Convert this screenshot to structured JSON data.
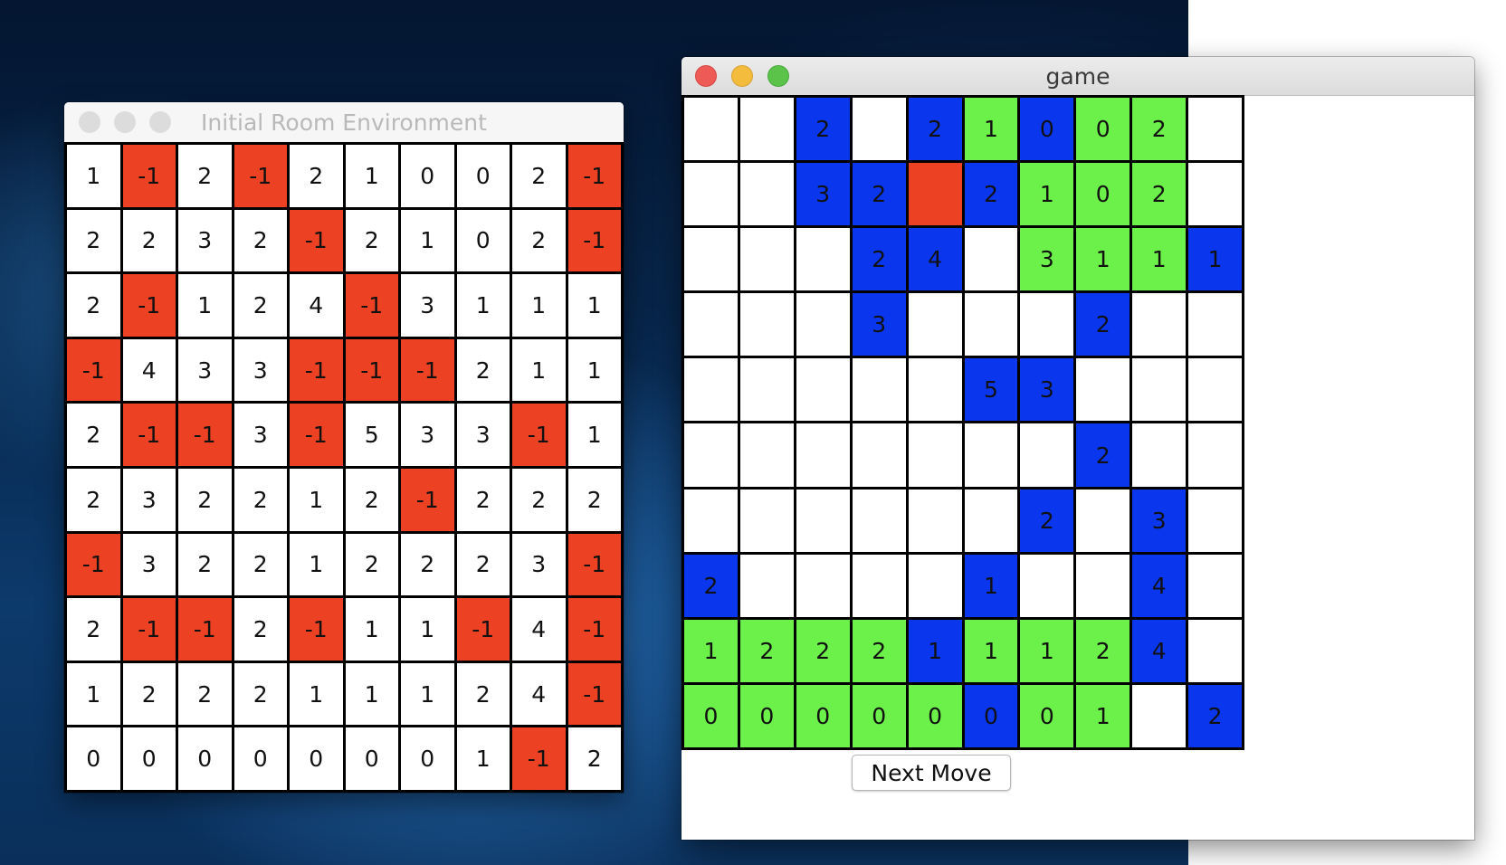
{
  "colors": {
    "obstacle": "#ec4123",
    "empty": "#ffffff",
    "visited": "#6cf04a",
    "frontier": "#0a37ee",
    "grid_line": "#000000",
    "close": "#ee5a55",
    "minimize": "#f4bc3c",
    "zoom": "#5bc34a",
    "inactive_dot": "#dcdcdc"
  },
  "env_window": {
    "title": "Initial Room Environment",
    "grid": [
      [
        "1",
        "-1",
        "2",
        "-1",
        "2",
        "1",
        "0",
        "0",
        "2",
        "-1"
      ],
      [
        "2",
        "2",
        "3",
        "2",
        "-1",
        "2",
        "1",
        "0",
        "2",
        "-1"
      ],
      [
        "2",
        "-1",
        "1",
        "2",
        "4",
        "-1",
        "3",
        "1",
        "1",
        "1"
      ],
      [
        "-1",
        "4",
        "3",
        "3",
        "-1",
        "-1",
        "-1",
        "2",
        "1",
        "1"
      ],
      [
        "2",
        "-1",
        "-1",
        "3",
        "-1",
        "5",
        "3",
        "3",
        "-1",
        "1"
      ],
      [
        "2",
        "3",
        "2",
        "2",
        "1",
        "2",
        "-1",
        "2",
        "2",
        "2"
      ],
      [
        "-1",
        "3",
        "2",
        "2",
        "1",
        "2",
        "2",
        "2",
        "3",
        "-1"
      ],
      [
        "2",
        "-1",
        "-1",
        "2",
        "-1",
        "1",
        "1",
        "-1",
        "4",
        "-1"
      ],
      [
        "1",
        "2",
        "2",
        "2",
        "1",
        "1",
        "1",
        "2",
        "4",
        "-1"
      ],
      [
        "0",
        "0",
        "0",
        "0",
        "0",
        "0",
        "0",
        "1",
        "-1",
        "2"
      ]
    ]
  },
  "game_window": {
    "title": "game",
    "next_move_label": "Next Move",
    "grid": [
      [
        {
          "v": "",
          "s": "empty"
        },
        {
          "v": "",
          "s": "empty"
        },
        {
          "v": "2",
          "s": "frontier"
        },
        {
          "v": "",
          "s": "empty"
        },
        {
          "v": "2",
          "s": "frontier"
        },
        {
          "v": "1",
          "s": "visited"
        },
        {
          "v": "0",
          "s": "frontier"
        },
        {
          "v": "0",
          "s": "visited"
        },
        {
          "v": "2",
          "s": "visited"
        },
        {
          "v": "",
          "s": "empty"
        }
      ],
      [
        {
          "v": "",
          "s": "empty"
        },
        {
          "v": "",
          "s": "empty"
        },
        {
          "v": "3",
          "s": "frontier"
        },
        {
          "v": "2",
          "s": "frontier"
        },
        {
          "v": "",
          "s": "obstacle"
        },
        {
          "v": "2",
          "s": "frontier"
        },
        {
          "v": "1",
          "s": "visited"
        },
        {
          "v": "0",
          "s": "visited"
        },
        {
          "v": "2",
          "s": "visited"
        },
        {
          "v": "",
          "s": "empty"
        }
      ],
      [
        {
          "v": "",
          "s": "empty"
        },
        {
          "v": "",
          "s": "empty"
        },
        {
          "v": "",
          "s": "empty"
        },
        {
          "v": "2",
          "s": "frontier"
        },
        {
          "v": "4",
          "s": "frontier"
        },
        {
          "v": "",
          "s": "empty"
        },
        {
          "v": "3",
          "s": "visited"
        },
        {
          "v": "1",
          "s": "visited"
        },
        {
          "v": "1",
          "s": "visited"
        },
        {
          "v": "1",
          "s": "frontier"
        }
      ],
      [
        {
          "v": "",
          "s": "empty"
        },
        {
          "v": "",
          "s": "empty"
        },
        {
          "v": "",
          "s": "empty"
        },
        {
          "v": "3",
          "s": "frontier"
        },
        {
          "v": "",
          "s": "empty"
        },
        {
          "v": "",
          "s": "empty"
        },
        {
          "v": "",
          "s": "empty"
        },
        {
          "v": "2",
          "s": "frontier"
        },
        {
          "v": "",
          "s": "empty"
        },
        {
          "v": "",
          "s": "empty"
        }
      ],
      [
        {
          "v": "",
          "s": "empty"
        },
        {
          "v": "",
          "s": "empty"
        },
        {
          "v": "",
          "s": "empty"
        },
        {
          "v": "",
          "s": "empty"
        },
        {
          "v": "",
          "s": "empty"
        },
        {
          "v": "5",
          "s": "frontier"
        },
        {
          "v": "3",
          "s": "frontier"
        },
        {
          "v": "",
          "s": "empty"
        },
        {
          "v": "",
          "s": "empty"
        },
        {
          "v": "",
          "s": "empty"
        }
      ],
      [
        {
          "v": "",
          "s": "empty"
        },
        {
          "v": "",
          "s": "empty"
        },
        {
          "v": "",
          "s": "empty"
        },
        {
          "v": "",
          "s": "empty"
        },
        {
          "v": "",
          "s": "empty"
        },
        {
          "v": "",
          "s": "empty"
        },
        {
          "v": "",
          "s": "empty"
        },
        {
          "v": "2",
          "s": "frontier"
        },
        {
          "v": "",
          "s": "empty"
        },
        {
          "v": "",
          "s": "empty"
        }
      ],
      [
        {
          "v": "",
          "s": "empty"
        },
        {
          "v": "",
          "s": "empty"
        },
        {
          "v": "",
          "s": "empty"
        },
        {
          "v": "",
          "s": "empty"
        },
        {
          "v": "",
          "s": "empty"
        },
        {
          "v": "",
          "s": "empty"
        },
        {
          "v": "2",
          "s": "frontier"
        },
        {
          "v": "",
          "s": "empty"
        },
        {
          "v": "3",
          "s": "frontier"
        },
        {
          "v": "",
          "s": "empty"
        }
      ],
      [
        {
          "v": "2",
          "s": "frontier"
        },
        {
          "v": "",
          "s": "empty"
        },
        {
          "v": "",
          "s": "empty"
        },
        {
          "v": "",
          "s": "empty"
        },
        {
          "v": "",
          "s": "empty"
        },
        {
          "v": "1",
          "s": "frontier"
        },
        {
          "v": "",
          "s": "empty"
        },
        {
          "v": "",
          "s": "empty"
        },
        {
          "v": "4",
          "s": "frontier"
        },
        {
          "v": "",
          "s": "empty"
        }
      ],
      [
        {
          "v": "1",
          "s": "visited"
        },
        {
          "v": "2",
          "s": "visited"
        },
        {
          "v": "2",
          "s": "visited"
        },
        {
          "v": "2",
          "s": "visited"
        },
        {
          "v": "1",
          "s": "frontier"
        },
        {
          "v": "1",
          "s": "visited"
        },
        {
          "v": "1",
          "s": "visited"
        },
        {
          "v": "2",
          "s": "visited"
        },
        {
          "v": "4",
          "s": "frontier"
        },
        {
          "v": "",
          "s": "empty"
        }
      ],
      [
        {
          "v": "0",
          "s": "visited"
        },
        {
          "v": "0",
          "s": "visited"
        },
        {
          "v": "0",
          "s": "visited"
        },
        {
          "v": "0",
          "s": "visited"
        },
        {
          "v": "0",
          "s": "visited"
        },
        {
          "v": "0",
          "s": "frontier"
        },
        {
          "v": "0",
          "s": "visited"
        },
        {
          "v": "1",
          "s": "visited"
        },
        {
          "v": "",
          "s": "empty"
        },
        {
          "v": "2",
          "s": "frontier"
        }
      ]
    ]
  }
}
